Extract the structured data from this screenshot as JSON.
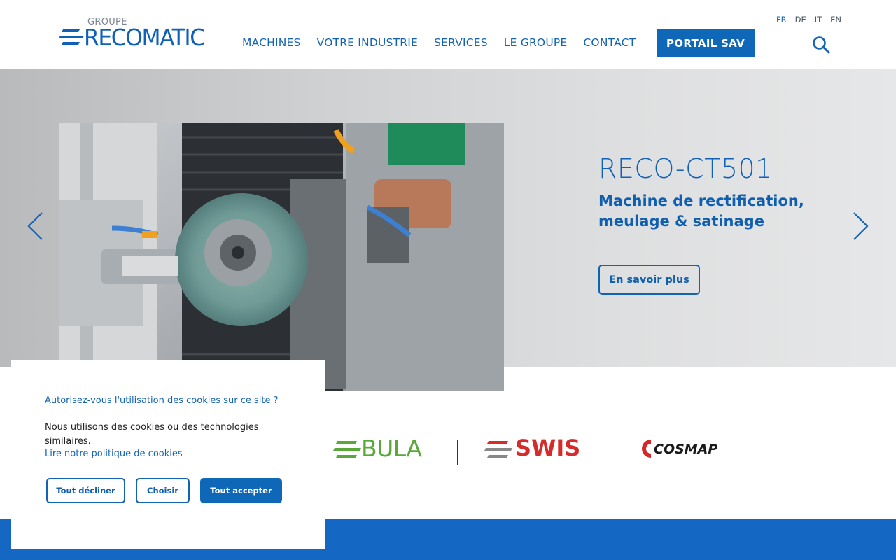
{
  "header": {
    "logo_group": "GROUPE",
    "logo_name": "RECOMATIC",
    "nav": [
      "MACHINES",
      "VOTRE INDUSTRIE",
      "SERVICES",
      "LE GROUPE",
      "CONTACT"
    ],
    "portal_button": "PORTAIL SAV",
    "languages": [
      "FR",
      "DE",
      "IT",
      "EN"
    ],
    "active_language": "FR"
  },
  "hero": {
    "title": "RECO-CT501",
    "subtitle": "Machine de rectification, meulage & satinage",
    "cta": "En savoir plus",
    "image_alt": "grinding machine"
  },
  "brands": [
    "BULA",
    "SWIS",
    "COSMAP"
  ],
  "cookie": {
    "question": "Autorisez-vous l'utilisation des cookies sur ce site ?",
    "text": "Nous utilisons des cookies ou des technologies similaires.",
    "policy_link": "Lire notre politique de cookies",
    "decline": "Tout décliner",
    "choose": "Choisir",
    "accept": "Tout accepter"
  },
  "colors": {
    "brand_blue": "#1160b8",
    "button_blue": "#0f67b7",
    "band_blue": "#1567c4",
    "bula_green": "#5aa83a",
    "swis_red": "#d62b2b",
    "cosmap_red": "#d9252a"
  }
}
